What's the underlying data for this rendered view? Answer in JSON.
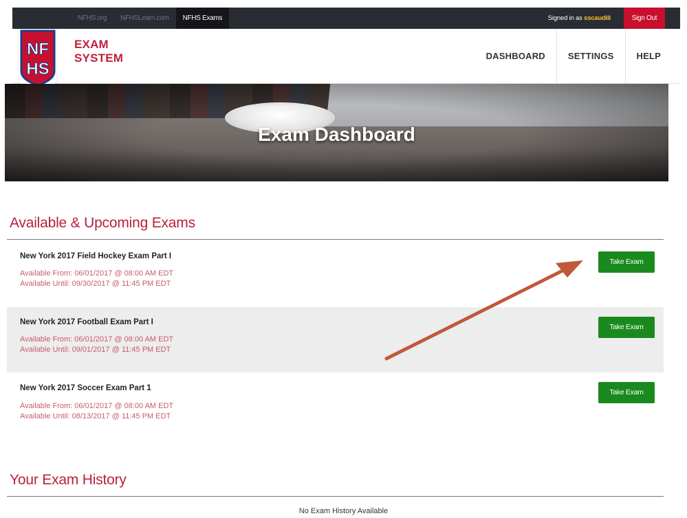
{
  "topbar": {
    "links": [
      "NFHS.org",
      "NFHSLearn.com",
      "NFHS Exams"
    ],
    "signed_prefix": "Signed in as",
    "username": "sscaudill",
    "signout_label": "Sign Out"
  },
  "header": {
    "logo_text": "NFHS",
    "brand_line1": "EXAM",
    "brand_line2": "SYSTEM",
    "nav": [
      "DASHBOARD",
      "SETTINGS",
      "HELP"
    ]
  },
  "hero": {
    "title": "Exam Dashboard"
  },
  "available": {
    "title": "Available & Upcoming Exams",
    "exams": [
      {
        "name": "New York 2017 Field Hockey Exam Part I",
        "from": "Available From: 06/01/2017 @ 08:00 AM EDT",
        "until": "Available Until:  09/30/2017 @ 11:45 PM EDT",
        "button": "Take Exam"
      },
      {
        "name": "New York 2017 Football Exam Part I",
        "from": "Available From: 06/01/2017 @ 08:00 AM EDT",
        "until": "Available Until:  09/01/2017 @ 11:45 PM EDT",
        "button": "Take Exam"
      },
      {
        "name": "New York 2017 Soccer Exam Part 1",
        "from": "Available From: 06/01/2017 @ 08:00 AM EDT",
        "until": "Available Until:  08/13/2017 @ 11:45 PM EDT",
        "button": "Take Exam"
      }
    ]
  },
  "history": {
    "title": "Your Exam History",
    "empty_text": "No Exam History Available"
  },
  "colors": {
    "accent": "#c31d3b",
    "button": "#1a8a1f",
    "signout": "#c8102e",
    "topbar": "#2a2c33",
    "annotation_arrow": "#c0593a"
  }
}
